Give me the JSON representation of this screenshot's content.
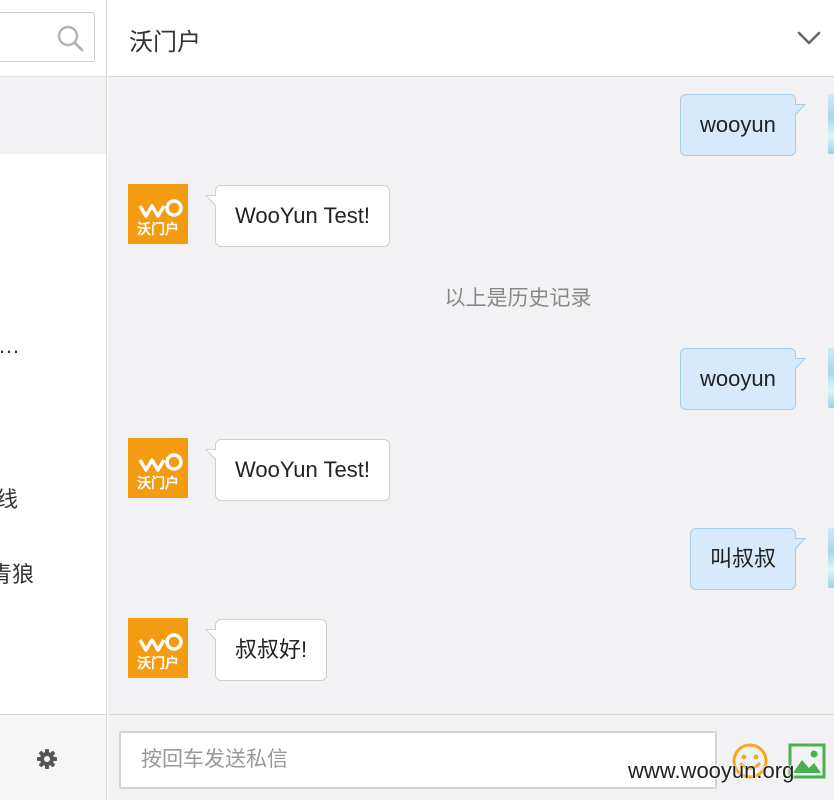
{
  "sidebar": {
    "conversation_fragments": [
      "…",
      "线",
      "青狼"
    ]
  },
  "header": {
    "title": "沃门户"
  },
  "contact": {
    "avatar_text": "沃门户",
    "avatar_color": "#f39c12"
  },
  "messages": [
    {
      "direction": "out",
      "text": "wooyun"
    },
    {
      "direction": "in",
      "text": "WooYun Test!"
    },
    {
      "direction": "out",
      "text": "wooyun"
    },
    {
      "direction": "in",
      "text": "WooYun Test!"
    },
    {
      "direction": "out",
      "text": "叫叔叔"
    },
    {
      "direction": "in",
      "text": "叔叔好!"
    }
  ],
  "history_note": "以上是历史记录",
  "composer": {
    "placeholder": "按回车发送私信"
  },
  "watermark": "www.wooyun.org",
  "colors": {
    "outgoing_bubble": "#d6eafb",
    "incoming_bubble": "#ffffff",
    "chat_background": "#f2f2f4",
    "emoji_icon": "#f5a623",
    "image_icon": "#4caf50"
  }
}
